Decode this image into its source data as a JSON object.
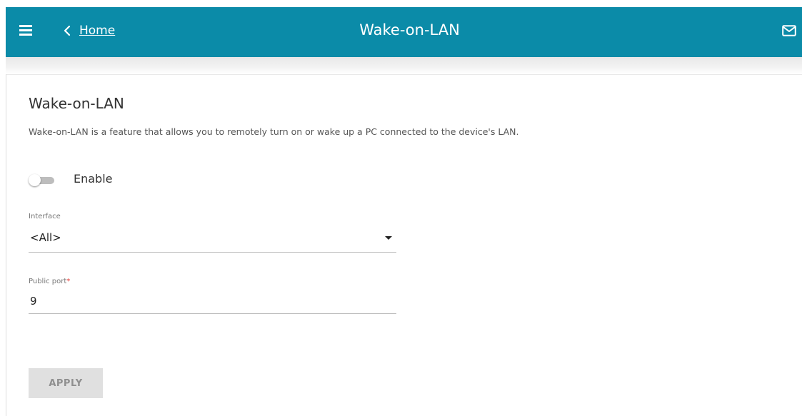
{
  "header": {
    "back_label": "Home",
    "title": "Wake-on-LAN",
    "bar_color": "#0b8ba8",
    "icons": [
      "menu-icon",
      "back-chevron-icon",
      "mail-icon"
    ]
  },
  "main": {
    "title": "Wake-on-LAN",
    "description": "Wake-on-LAN is a feature that allows you to remotely turn on or wake up a PC connected to the device's LAN.",
    "enable": {
      "label": "Enable",
      "checked": false
    },
    "interface": {
      "label": "Interface",
      "value": "<All>"
    },
    "public_port": {
      "label": "Public port",
      "required_mark": "*",
      "value": "9"
    },
    "apply_label": "APPLY"
  }
}
